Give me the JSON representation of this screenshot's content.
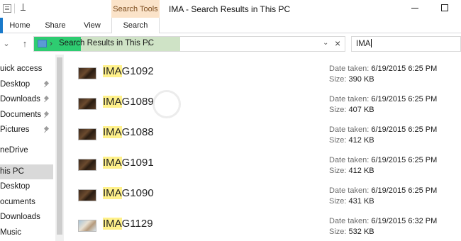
{
  "title_bar": {
    "context_tab": "Search Tools",
    "window_title": "IMA - Search Results in This PC"
  },
  "ribbon": {
    "tabs": [
      {
        "label": "Home"
      },
      {
        "label": "Share"
      },
      {
        "label": "View"
      },
      {
        "label": "Search",
        "active": true
      }
    ]
  },
  "address": {
    "path": "Search Results in This PC",
    "search_value": "IMA"
  },
  "nav_pane": {
    "items": [
      {
        "label": "uick access",
        "pinned": false
      },
      {
        "label": "Desktop",
        "pinned": true
      },
      {
        "label": "Downloads",
        "pinned": true
      },
      {
        "label": "Documents",
        "pinned": true
      },
      {
        "label": "Pictures",
        "pinned": true
      },
      {
        "label": "neDrive",
        "pinned": false
      },
      {
        "label": "his PC",
        "selected": true
      },
      {
        "label": "Desktop",
        "pinned": false
      },
      {
        "label": "ocuments",
        "pinned": false
      },
      {
        "label": "Downloads",
        "pinned": false
      },
      {
        "label": "Music",
        "pinned": false
      }
    ]
  },
  "results": {
    "highlight": "IMA",
    "date_label": "Date taken:",
    "size_label": "Size:",
    "items": [
      {
        "name_rest": "G1092",
        "date": "6/19/2015 6:25 PM",
        "size": "390 KB",
        "thumb": "dark"
      },
      {
        "name_rest": "G1089",
        "date": "6/19/2015 6:25 PM",
        "size": "407 KB",
        "thumb": "dark"
      },
      {
        "name_rest": "G1088",
        "date": "6/19/2015 6:25 PM",
        "size": "412 KB",
        "thumb": "dark"
      },
      {
        "name_rest": "G1091",
        "date": "6/19/2015 6:25 PM",
        "size": "412 KB",
        "thumb": "dark"
      },
      {
        "name_rest": "G1090",
        "date": "6/19/2015 6:25 PM",
        "size": "431 KB",
        "thumb": "dark"
      },
      {
        "name_rest": "G1129",
        "date": "6/19/2015 6:32 PM",
        "size": "532 KB",
        "thumb": "light"
      }
    ]
  },
  "colors": {
    "search_tools_tab": "#fbe3c9",
    "selection": "#d9d9d9",
    "highlight": "#fff18a",
    "address_progress": "#2ecc71"
  }
}
